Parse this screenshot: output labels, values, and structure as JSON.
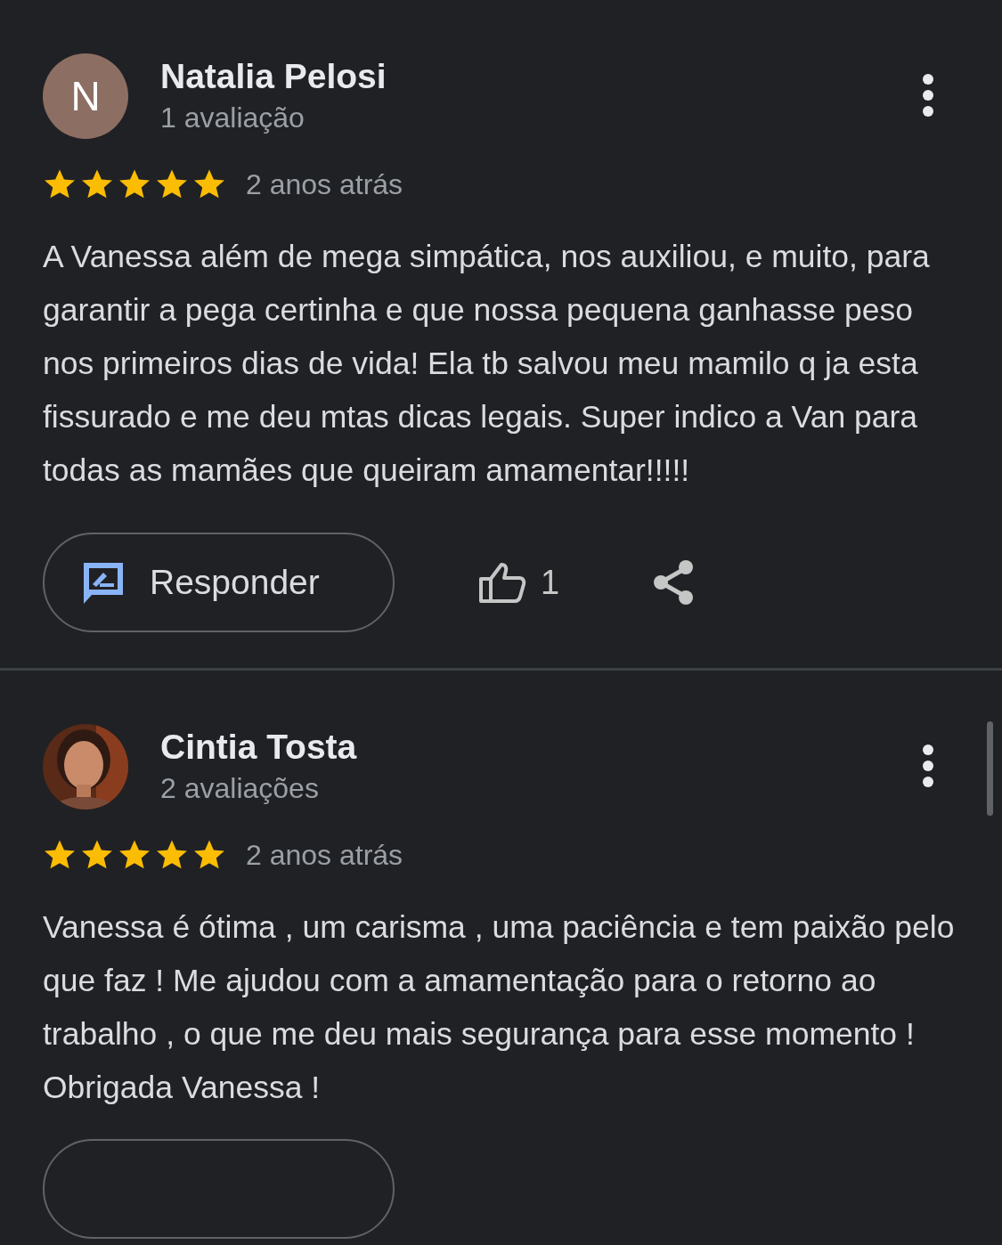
{
  "reviews": [
    {
      "name": "Natalia Pelosi",
      "avatar": {
        "kind": "letter",
        "letter": "N",
        "color": "#8d6e63"
      },
      "count": "1 avaliação",
      "stars": 5,
      "time": "2 anos atrás",
      "text": "A Vanessa além de mega simpática, nos auxiliou, e muito, para garantir a pega certinha e que nossa pequena ganhasse peso nos primeiros dias de vida! Ela tb salvou meu mamilo q ja esta fissurado e me deu mtas dicas legais. Super indico a Van para todas as mamães que queiram amamentar!!!!!",
      "actions": {
        "kind": "full",
        "reply": "Responder",
        "likes": "1"
      }
    },
    {
      "name": "Cintia Tosta",
      "count": "2 avaliações",
      "stars": 5,
      "time": "2 anos atrás",
      "text": "Vanessa é ótima , um carisma , uma paciência e tem paixão pelo que faz ! Me ajudou com a amamentação para o retorno ao trabalho , o que me deu mais segurança para esse momento ! Obrigada Vanessa !",
      "actions": {
        "kind": "clipped"
      }
    }
  ]
}
